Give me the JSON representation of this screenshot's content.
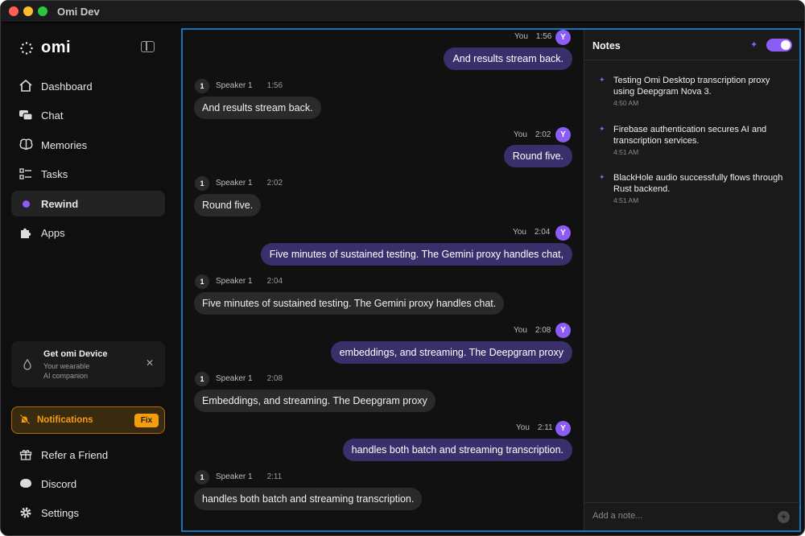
{
  "window": {
    "title": "Omi Dev"
  },
  "sidebar": {
    "logo_text": "omi",
    "nav": [
      {
        "label": "Dashboard",
        "icon": "home-icon"
      },
      {
        "label": "Chat",
        "icon": "chat-icon"
      },
      {
        "label": "Memories",
        "icon": "brain-icon"
      },
      {
        "label": "Tasks",
        "icon": "tasks-icon"
      },
      {
        "label": "Rewind",
        "icon": "rewind-dot-icon",
        "active": true
      },
      {
        "label": "Apps",
        "icon": "puzzle-icon"
      }
    ],
    "device_card": {
      "title": "Get omi Device",
      "subtitle_line1": "Your wearable",
      "subtitle_line2": "AI companion"
    },
    "notifications": {
      "label": "Notifications",
      "fix_label": "Fix"
    },
    "bottom": [
      {
        "label": "Refer a Friend",
        "icon": "gift-icon"
      },
      {
        "label": "Discord",
        "icon": "discord-icon"
      },
      {
        "label": "Settings",
        "icon": "gear-icon"
      }
    ]
  },
  "chat": {
    "you_label": "You",
    "avatar_letter": "Y",
    "speaker_badge": "1",
    "speaker_label": "Speaker 1",
    "messages": [
      {
        "from": "you",
        "time": "1:56",
        "text": "And results stream back."
      },
      {
        "from": "speaker",
        "time": "1:56",
        "text": "And results stream back."
      },
      {
        "from": "you",
        "time": "2:02",
        "text": "Round five."
      },
      {
        "from": "speaker",
        "time": "2:02",
        "text": "Round five."
      },
      {
        "from": "you",
        "time": "2:04",
        "text": "Five minutes of sustained testing. The Gemini proxy handles chat,"
      },
      {
        "from": "speaker",
        "time": "2:04",
        "text": "Five minutes of sustained testing. The Gemini proxy handles chat."
      },
      {
        "from": "you",
        "time": "2:08",
        "text": "embeddings, and streaming. The Deepgram proxy"
      },
      {
        "from": "speaker",
        "time": "2:08",
        "text": "Embeddings, and streaming. The Deepgram proxy"
      },
      {
        "from": "you",
        "time": "2:11",
        "text": "handles both batch and streaming transcription."
      },
      {
        "from": "speaker",
        "time": "2:11",
        "text": "handles both batch and streaming transcription."
      }
    ]
  },
  "notes": {
    "title": "Notes",
    "toggle_on": true,
    "items": [
      {
        "text": "Testing Omi Desktop transcription proxy using Deepgram Nova 3.",
        "time": "4:50 AM"
      },
      {
        "text": "Firebase authentication secures AI and transcription services.",
        "time": "4:51 AM"
      },
      {
        "text": "BlackHole audio successfully flows through Rust backend.",
        "time": "4:51 AM"
      }
    ],
    "add_placeholder": "Add a note..."
  },
  "colors": {
    "accent": "#8b5cf6",
    "warning": "#f59e0b",
    "focus_border": "#1d73b8"
  }
}
